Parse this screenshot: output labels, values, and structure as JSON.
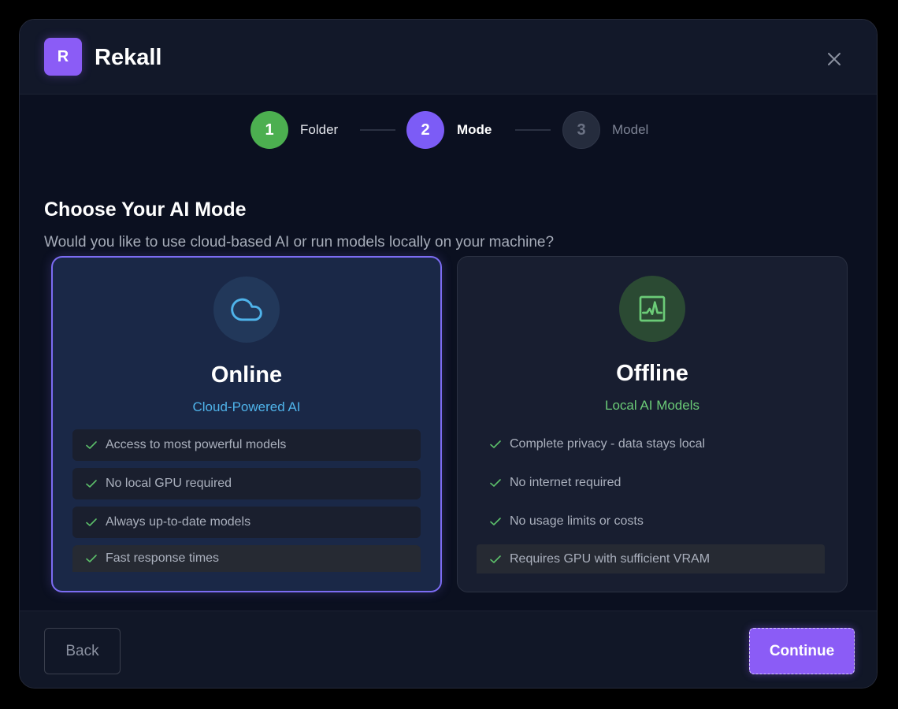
{
  "app": {
    "logo_letter": "R",
    "name": "Rekall"
  },
  "colors": {
    "accent": "#8b5cf6",
    "step_done": "#4caf50",
    "online_accent": "#4fb3ea",
    "offline_accent": "#6bcb77"
  },
  "steps": [
    {
      "number": "1",
      "label": "Folder",
      "state": "done"
    },
    {
      "number": "2",
      "label": "Mode",
      "state": "active"
    },
    {
      "number": "3",
      "label": "Model",
      "state": "pending"
    }
  ],
  "main": {
    "title": "Choose Your AI Mode",
    "subtitle": "Would you like to use cloud-based AI or run models locally on your machine?"
  },
  "cards": {
    "online": {
      "icon": "cloud-icon",
      "title": "Online",
      "subtitle": "Cloud-Powered AI",
      "selected": true,
      "features": [
        "Access to most powerful models",
        "No local GPU required",
        "Always up-to-date models",
        "Fast response times"
      ]
    },
    "offline": {
      "icon": "activity-monitor-icon",
      "title": "Offline",
      "subtitle": "Local AI Models",
      "selected": false,
      "features": [
        "Complete privacy - data stays local",
        "No internet required",
        "No usage limits or costs",
        "Requires GPU with sufficient VRAM"
      ]
    }
  },
  "footer": {
    "back_label": "Back",
    "continue_label": "Continue"
  }
}
